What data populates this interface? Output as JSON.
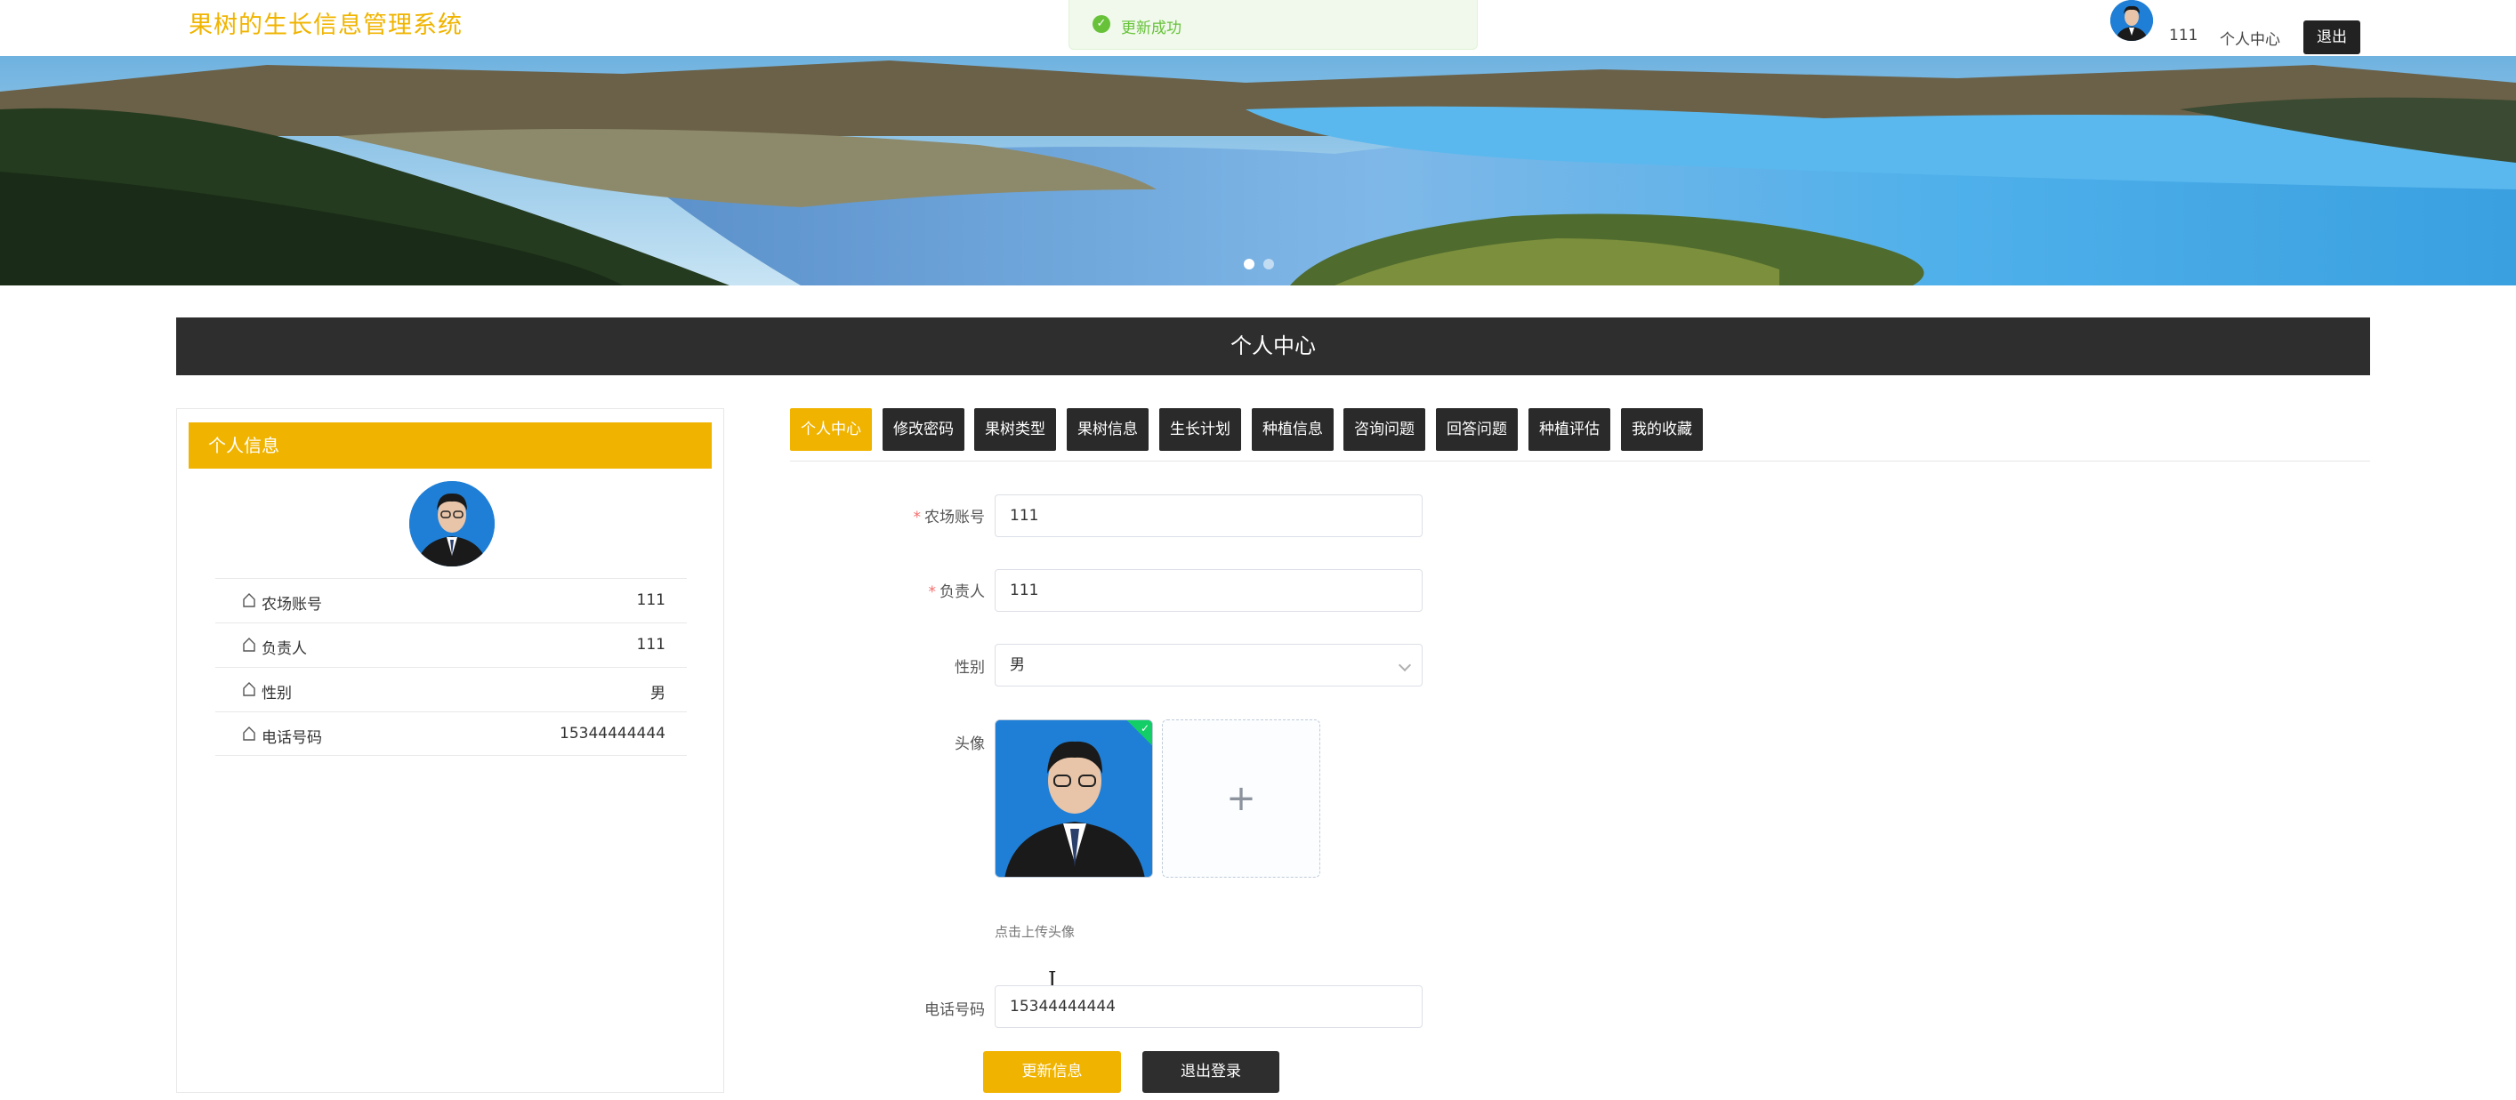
{
  "app": {
    "title": "果树的生长信息管理系统"
  },
  "toast": {
    "message": "更新成功",
    "status_color": "#67c23a"
  },
  "header": {
    "username": "111",
    "user_center": "个人中心",
    "logout": "退出"
  },
  "section": {
    "title": "个人中心"
  },
  "info_card": {
    "title": "个人信息",
    "rows": [
      {
        "label": "农场账号",
        "value": "111"
      },
      {
        "label": "负责人",
        "value": "111"
      },
      {
        "label": "性别",
        "value": "男"
      },
      {
        "label": "电话号码",
        "value": "15344444444"
      }
    ]
  },
  "tabs": [
    {
      "label": "个人中心",
      "active": true
    },
    {
      "label": "修改密码"
    },
    {
      "label": "果树类型"
    },
    {
      "label": "果树信息"
    },
    {
      "label": "生长计划"
    },
    {
      "label": "种植信息"
    },
    {
      "label": "咨询问题"
    },
    {
      "label": "回答问题"
    },
    {
      "label": "种植评估"
    },
    {
      "label": "我的收藏"
    }
  ],
  "form": {
    "account": {
      "label": "农场账号",
      "value": "111",
      "required": true
    },
    "manager": {
      "label": "负责人",
      "value": "111",
      "required": true
    },
    "gender": {
      "label": "性别",
      "value": "男"
    },
    "avatar": {
      "label": "头像",
      "tip": "点击上传头像",
      "add_icon": "plus-icon"
    },
    "phone": {
      "label": "电话号码",
      "value": "15344444444"
    },
    "update_button": "更新信息",
    "logout_button": "退出登录"
  },
  "colors": {
    "accent": "#f0b400",
    "dark": "#2e2e2e",
    "success": "#67c23a"
  }
}
